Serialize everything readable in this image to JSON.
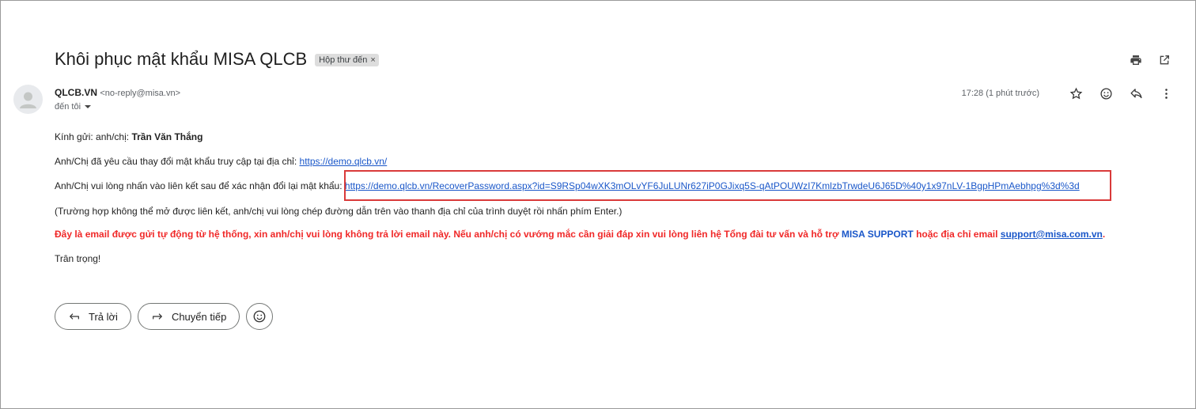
{
  "email": {
    "subject": "Khôi phục mật khẩu MISA QLCB",
    "label": "Hộp thư đến",
    "label_close": "×",
    "sender_name": "QLCB.VN",
    "sender_email": "<no-reply@misa.vn>",
    "to": "đến tôi",
    "time": "17:28 (1 phút trước)"
  },
  "body": {
    "greeting_prefix": "Kính gửi: anh/chị: ",
    "greeting_name": "Trần Văn Thắng",
    "line2_prefix": "Anh/Chị đã yêu cầu thay đổi mật khẩu truy cập tại địa chỉ: ",
    "line2_link": "https://demo.qlcb.vn/",
    "line3_prefix": "Anh/Chị vui lòng nhấn vào liên kết sau để xác nhận đổi lại mật khẩu: ",
    "line3_link": "https://demo.qlcb.vn/RecoverPassword.aspx?id=S9RSp04wXK3mOLvYF6JuLUNr627iP0GJixq5S-qAtPOUWzI7KmlzbTrwdeU6J65D%40y1x97nLV-1BgpHPmAebhpg%3d%3d",
    "line4": "(Trường hợp không thể mở được liên kết, anh/chị vui lòng chép đường dẫn trên vào thanh địa chỉ của trình duyệt rồi nhấn phím Enter.)",
    "line5_red": "Đây là email được gửi tự động từ hệ thống, xin anh/chị vui lòng không trả lời email này. Nếu anh/chị có vướng mắc cần giải đáp xin vui lòng liên hệ Tổng đài tư vấn và hỗ trợ ",
    "line5_support": "MISA SUPPORT",
    "line5_mid": " hoặc địa chỉ email ",
    "line5_email": "support@misa.com.vn",
    "line5_end": ".",
    "closing": "Trân trọng!"
  },
  "actions": {
    "reply": "Trả lời",
    "forward": "Chuyển tiếp"
  },
  "colors": {
    "link": "#1a57c9",
    "warning": "#f02828",
    "highlight_border": "#d93a3a"
  },
  "icons": [
    "print-icon",
    "open-new-window-icon",
    "star-icon",
    "emoji-icon",
    "reply-icon",
    "more-vert-icon",
    "dropdown-icon",
    "forward-icon",
    "avatar-icon"
  ]
}
